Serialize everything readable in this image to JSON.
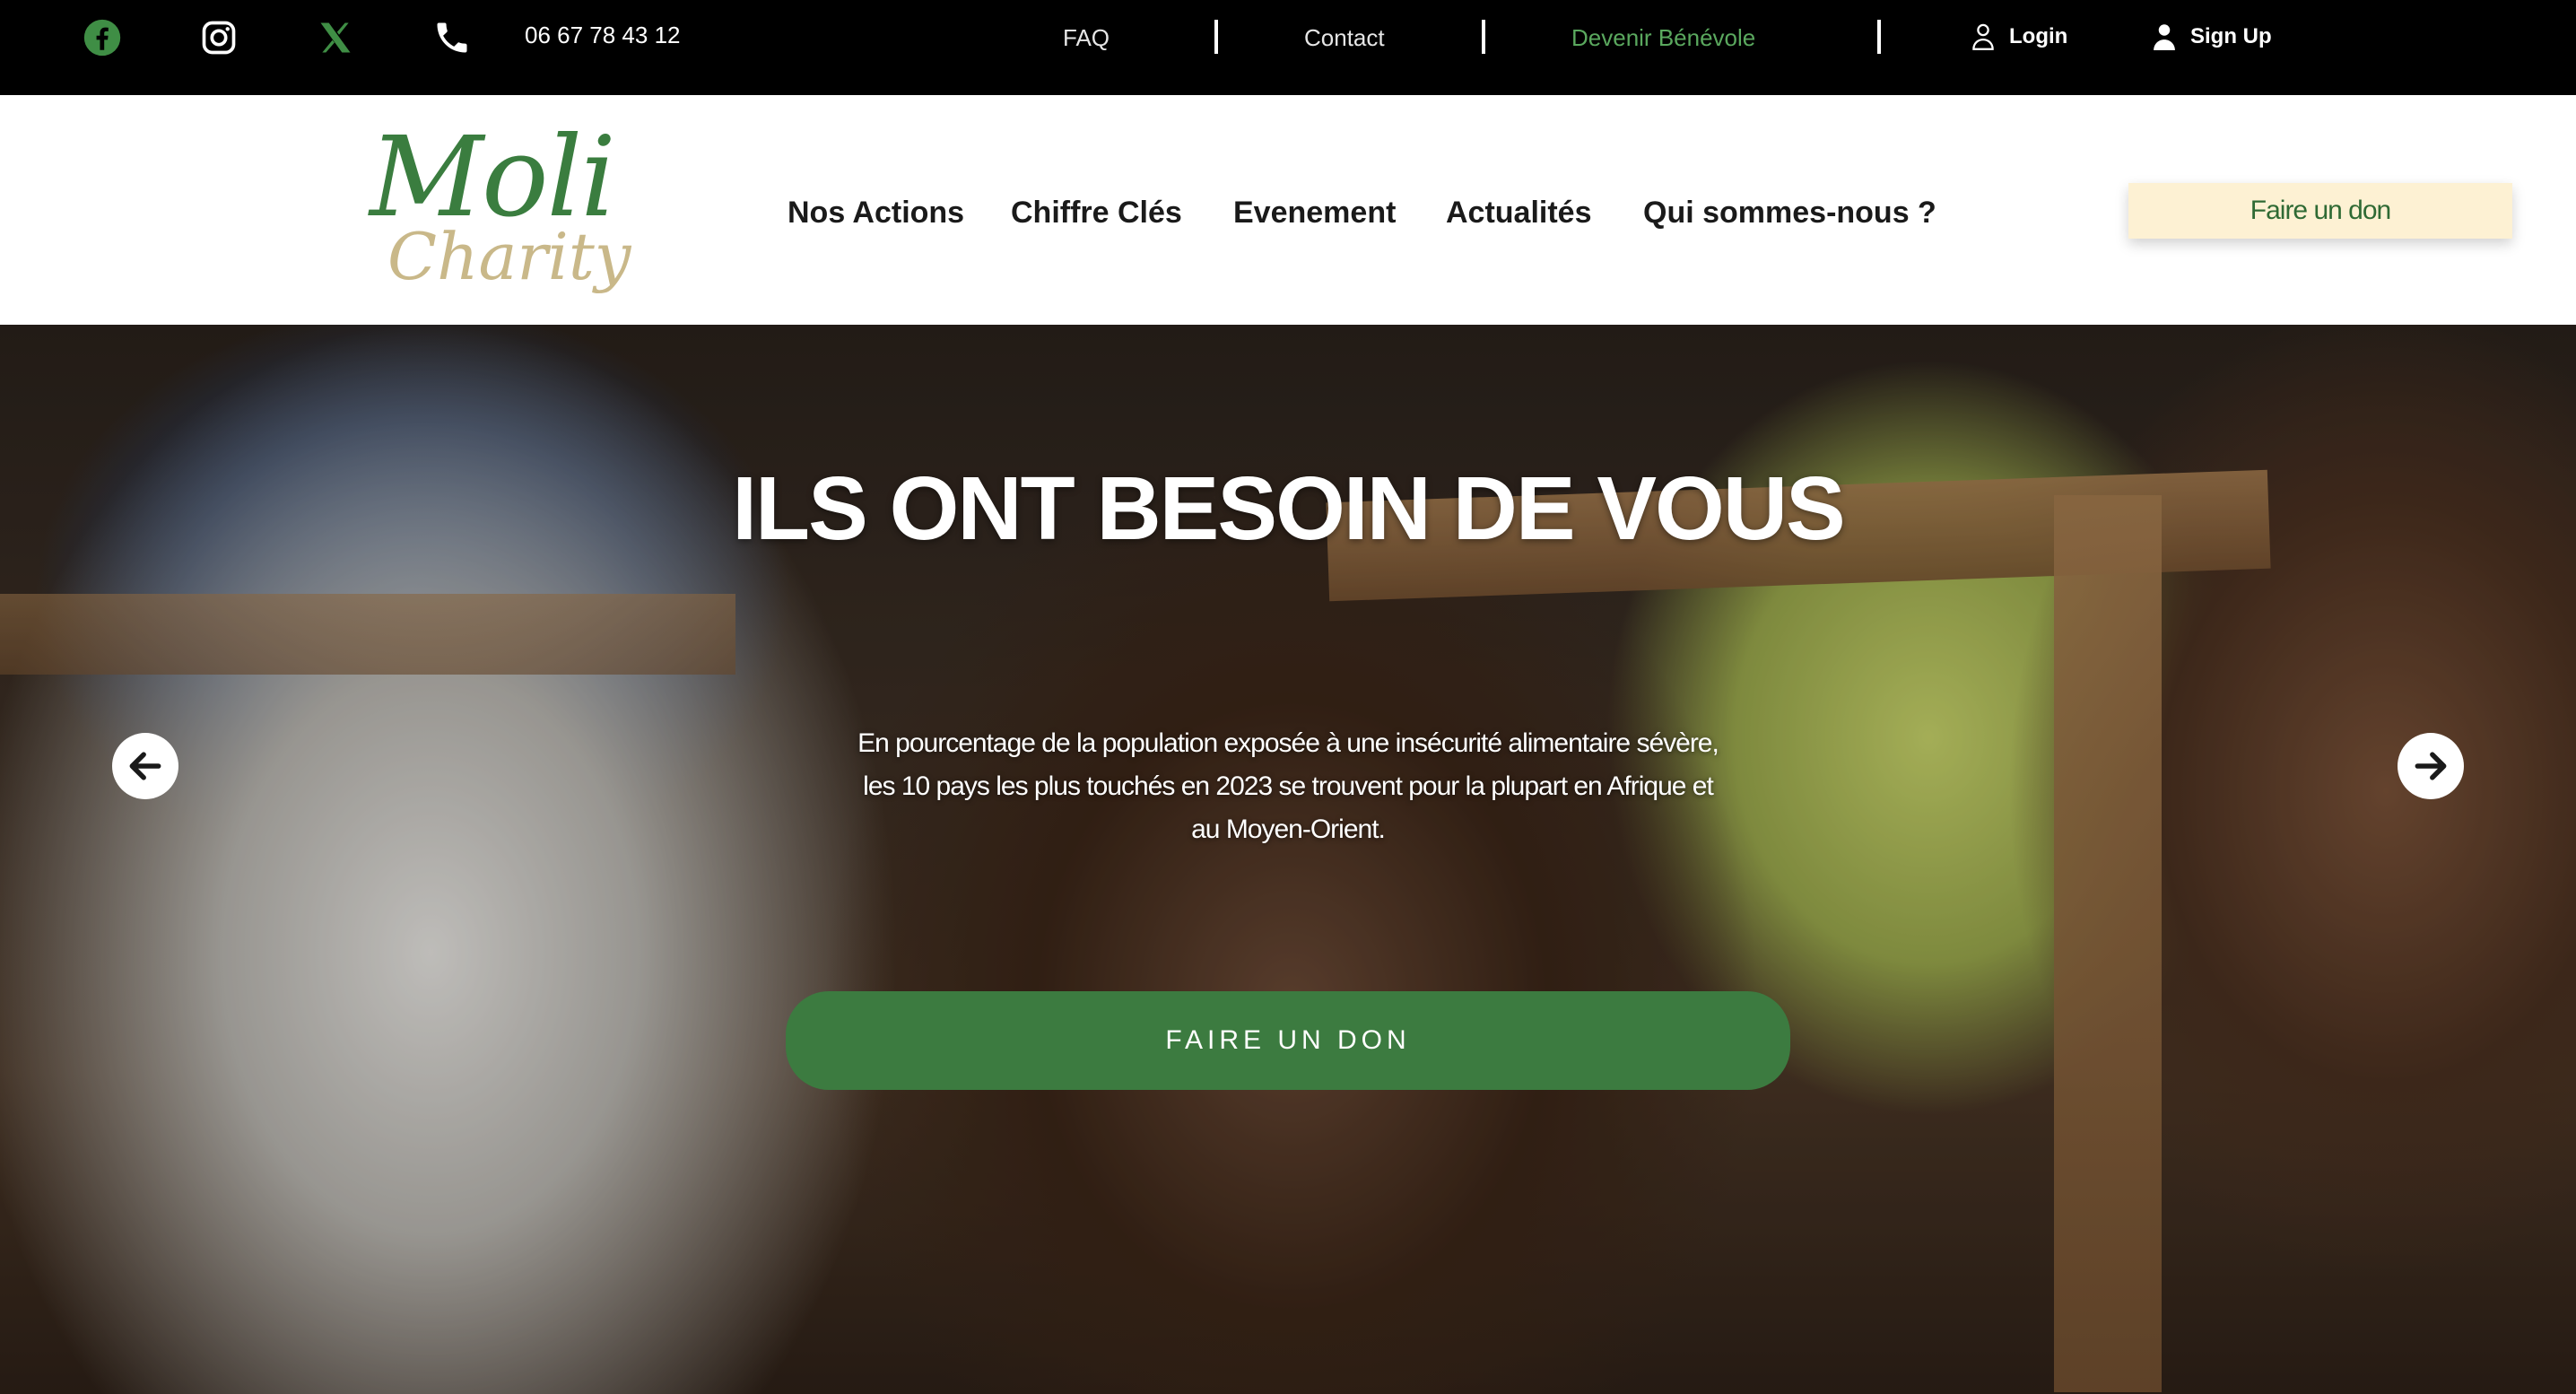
{
  "topbar": {
    "social_icons": [
      "facebook-icon",
      "instagram-icon",
      "x-icon",
      "phone-icon"
    ],
    "phone": "06 67 78 43 12",
    "links": {
      "faq": "FAQ",
      "contact": "Contact",
      "volunteer": "Devenir Bénévole"
    },
    "login": "Login",
    "signup": "Sign Up"
  },
  "header": {
    "logo": {
      "line1": "Moli",
      "line2": "Charity"
    },
    "nav": [
      "Nos Actions",
      "Chiffre Clés",
      "Evenement",
      "Actualités",
      "Qui sommes-nous ?"
    ],
    "donate_label": "Faire un don"
  },
  "hero": {
    "title": "ILS ONT BESOIN DE VOUS",
    "subtitle": "En pourcentage de la population exposée à une insécurité alimentaire sévère, les 10 pays les plus touchés en 2023 se trouvent pour la plupart en Afrique et au Moyen-Orient.",
    "cta_label": "FAIRE UN DON"
  },
  "colors": {
    "brand_green": "#3c7b40",
    "accent_green": "#5aa85e",
    "donate_bg": "#fdf1d3",
    "logo_tan": "#c9b889"
  }
}
